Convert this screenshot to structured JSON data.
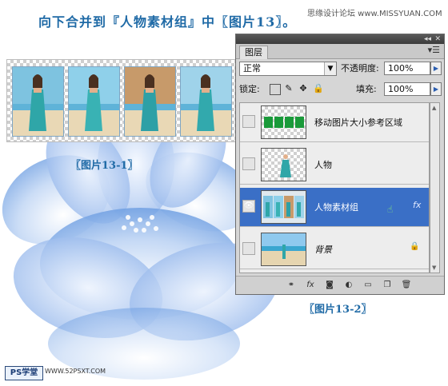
{
  "heading": "向下合并到『人物素材组』中〖图片13〗。",
  "watermark": "思缘设计论坛 www.MISSYUAN.COM",
  "caption_a": "〖图片13-1〗",
  "caption_b": "〖图片13-2〗",
  "photos": [
    {
      "bg": "#7ec3e0",
      "figure": "#2fa6a8"
    },
    {
      "bg": "#8fd0ea",
      "figure": "#39b2b4"
    },
    {
      "bg": "#c79a6a",
      "figure": "#2da0a6"
    },
    {
      "bg": "#9fd3ea",
      "figure": "#32a9ad"
    }
  ],
  "panel": {
    "tab": "图层",
    "blend_mode": "正常",
    "opacity_label": "不透明度:",
    "opacity_value": "100%",
    "lock_label": "锁定:",
    "fill_label": "填充:",
    "fill_value": "100%",
    "layers": [
      {
        "name": "移动图片大小参考区域",
        "visible": false,
        "selected": false,
        "thumb": "green-blocks"
      },
      {
        "name": "人物",
        "visible": false,
        "selected": false,
        "thumb": "figure"
      },
      {
        "name": "人物素材组",
        "visible": true,
        "selected": true,
        "thumb": "photo-group",
        "fx": "fx"
      },
      {
        "name": "背景",
        "visible": false,
        "selected": false,
        "thumb": "beach",
        "locked": true
      }
    ],
    "bottom_icons": [
      "link-icon",
      "fx-icon",
      "mask-icon",
      "adjustment-icon",
      "folder-icon",
      "new-layer-icon",
      "trash-icon"
    ]
  },
  "logo": {
    "badge": "PS学堂",
    "url": "WWW.52PSXT.COM"
  },
  "colors": {
    "accent": "#1f6aa6",
    "selected_layer": "#3a6fc6"
  }
}
